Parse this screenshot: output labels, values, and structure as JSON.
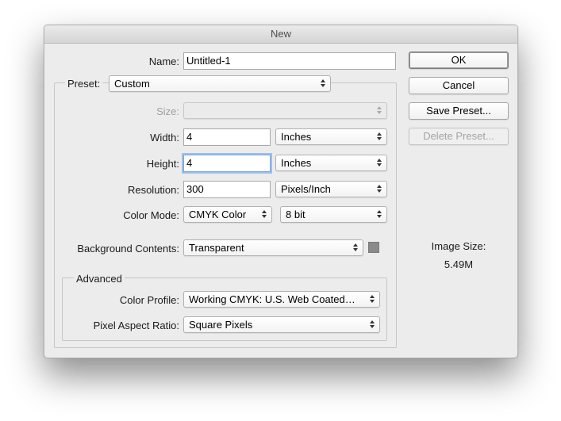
{
  "window": {
    "title": "New"
  },
  "fields": {
    "name": {
      "label": "Name:",
      "value": "Untitled-1"
    },
    "preset": {
      "label": "Preset:",
      "value": "Custom"
    },
    "size": {
      "label": "Size:",
      "value": ""
    },
    "width": {
      "label": "Width:",
      "value": "4",
      "unit": "Inches"
    },
    "height": {
      "label": "Height:",
      "value": "4",
      "unit": "Inches"
    },
    "resolution": {
      "label": "Resolution:",
      "value": "300",
      "unit": "Pixels/Inch"
    },
    "color_mode": {
      "label": "Color Mode:",
      "value": "CMYK Color",
      "depth": "8 bit"
    },
    "background": {
      "label": "Background Contents:",
      "value": "Transparent",
      "swatch_color": "#8a8a8a"
    }
  },
  "advanced": {
    "title": "Advanced",
    "color_profile": {
      "label": "Color Profile:",
      "value": "Working CMYK:  U.S. Web Coated…"
    },
    "pixel_aspect": {
      "label": "Pixel Aspect Ratio:",
      "value": "Square Pixels"
    }
  },
  "buttons": {
    "ok": "OK",
    "cancel": "Cancel",
    "save_preset": "Save Preset...",
    "delete_preset": "Delete Preset..."
  },
  "image_size": {
    "label": "Image Size:",
    "value": "5.49M"
  },
  "colors": {
    "focus_ring": "#9ec1ea",
    "window_bg": "#ececec"
  }
}
